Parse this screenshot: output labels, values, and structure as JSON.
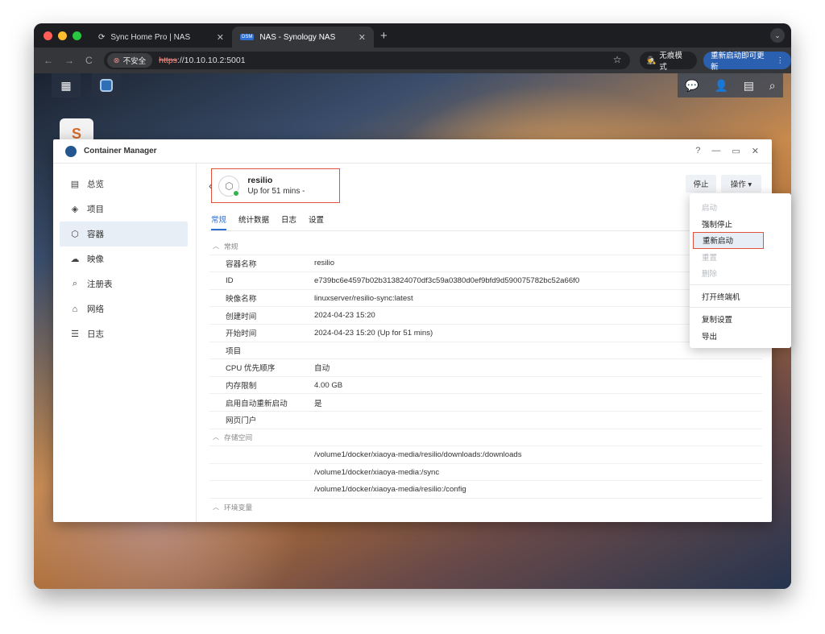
{
  "browser": {
    "tabs": [
      {
        "icon": "sync-icon",
        "title": "Sync Home Pro | NAS",
        "active": false
      },
      {
        "icon": "dsm-icon",
        "icon_text": "DSM",
        "title": "NAS - Synology NAS",
        "active": true
      }
    ],
    "new_tab": "+",
    "insecure_label": "不安全",
    "url_scheme": "https",
    "url_rest": "://10.10.10.2:5001",
    "incognito_label": "无痕模式",
    "update_label": "重新启动即可更新"
  },
  "desktop": {
    "app_icon_letter": "S"
  },
  "app": {
    "title": "Container Manager",
    "window_controls": [
      "?",
      "—",
      "▭",
      "✕"
    ],
    "sidebar": [
      {
        "icon": "overview-icon",
        "glyph": "▤",
        "label": "总览",
        "active": false
      },
      {
        "icon": "project-icon",
        "glyph": "◈",
        "label": "项目",
        "active": false
      },
      {
        "icon": "container-icon",
        "glyph": "⬡",
        "label": "容器",
        "active": true
      },
      {
        "icon": "image-icon",
        "glyph": "☁",
        "label": "映像",
        "active": false
      },
      {
        "icon": "registry-icon",
        "glyph": "⌕",
        "label": "注册表",
        "active": false
      },
      {
        "icon": "network-icon",
        "glyph": "⌂",
        "label": "网络",
        "active": false
      },
      {
        "icon": "log-icon",
        "glyph": "☰",
        "label": "日志",
        "active": false
      }
    ],
    "container": {
      "name": "resilio",
      "status": "Up for 51 mins -"
    },
    "buttons": {
      "stop": "停止",
      "action": "操作 ▾"
    },
    "tabs": [
      "常规",
      "统计数据",
      "日志",
      "设置"
    ],
    "sections": [
      {
        "title": "常规",
        "rows": [
          {
            "key": "容器名称",
            "value": "resilio"
          },
          {
            "key": "ID",
            "value": "e739bc6e4597b02b313824070df3c59a0380d0ef9bfd9d590075782bc52a66f0"
          },
          {
            "key": "映像名称",
            "value": "linuxserver/resilio-sync:latest"
          },
          {
            "key": "创建时间",
            "value": "2024-04-23 15:20"
          },
          {
            "key": "开始时间",
            "value": "2024-04-23 15:20 (Up for 51 mins)"
          },
          {
            "key": "项目",
            "value": ""
          },
          {
            "key": "CPU 优先顺序",
            "value": "自动"
          },
          {
            "key": "内存限制",
            "value": "4.00 GB"
          },
          {
            "key": "启用自动重新启动",
            "value": "是"
          },
          {
            "key": "网页门户",
            "value": ""
          }
        ]
      },
      {
        "title": "存储空间",
        "rows": [
          {
            "key": "",
            "value": "/volume1/docker/xiaoya-media/resilio/downloads:/downloads"
          },
          {
            "key": "",
            "value": "/volume1/docker/xiaoya-media:/sync"
          },
          {
            "key": "",
            "value": "/volume1/docker/xiaoya-media/resilio:/config"
          }
        ]
      },
      {
        "title": "环境变量",
        "rows": []
      }
    ]
  },
  "action_menu": [
    {
      "label": "启动",
      "disabled": true
    },
    {
      "label": "强制停止",
      "disabled": false
    },
    {
      "label": "重新启动",
      "disabled": false,
      "highlight": true
    },
    {
      "label": "重置",
      "disabled": true
    },
    {
      "label": "删除",
      "disabled": true
    },
    {
      "sep": true
    },
    {
      "label": "打开终端机",
      "disabled": false
    },
    {
      "sep": true
    },
    {
      "label": "复制设置",
      "disabled": false
    },
    {
      "label": "导出",
      "disabled": false
    }
  ],
  "colors": {
    "accent": "#2f6fcf",
    "highlight_border": "#e0533a",
    "running": "#38b24a"
  }
}
